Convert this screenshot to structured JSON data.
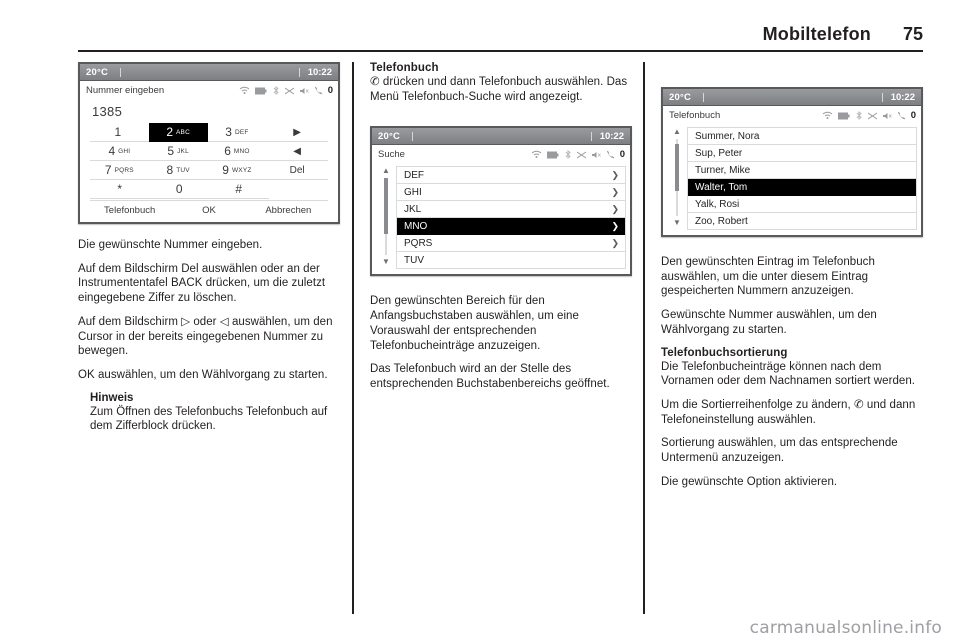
{
  "header": {
    "title": "Mobiltelefon",
    "page_number": "75"
  },
  "footer": {
    "watermark": "carmanualsonline.info"
  },
  "screens": {
    "dial": {
      "temperature": "20°C",
      "clock": "10:22",
      "title": "Nummer eingeben",
      "status_icons": [
        "signal-icon",
        "battery-icon",
        "bluetooth-icon",
        "shuffle-icon",
        "mute-icon",
        "phone-icon",
        "message-count-badge"
      ],
      "badge_value": "0",
      "entered_number": "1385",
      "keys": [
        {
          "digit": "1",
          "letters": ""
        },
        {
          "digit": "2",
          "letters": "ABC"
        },
        {
          "digit": "3",
          "letters": "DEF"
        },
        {
          "digit": "4",
          "letters": "GHI"
        },
        {
          "digit": "5",
          "letters": "JKL"
        },
        {
          "digit": "6",
          "letters": "MNO"
        },
        {
          "digit": "7",
          "letters": "PQRS"
        },
        {
          "digit": "8",
          "letters": "TUV"
        },
        {
          "digit": "9",
          "letters": "WXYZ"
        },
        {
          "digit": "*",
          "letters": ""
        },
        {
          "digit": "0",
          "letters": ""
        },
        {
          "digit": "#",
          "letters": ""
        }
      ],
      "selected_key": "2",
      "side_keys": [
        "▶",
        "◀",
        "Del"
      ],
      "footer_buttons": [
        "Telefonbuch",
        "OK",
        "Abbrechen"
      ]
    },
    "search": {
      "temperature": "20°C",
      "clock": "10:22",
      "title": "Suche",
      "badge_value": "0",
      "items": [
        "DEF",
        "GHI",
        "JKL",
        "MNO",
        "PQRS",
        "TUV"
      ],
      "selected_item": "MNO"
    },
    "phonebook": {
      "temperature": "20°C",
      "clock": "10:22",
      "title": "Telefonbuch",
      "badge_value": "0",
      "items": [
        "Summer, Nora",
        "Sup, Peter",
        "Turner, Mike",
        "Walter, Tom",
        "Yalk, Rosi",
        "Zoo, Robert"
      ],
      "selected_item": "Walter, Tom"
    }
  },
  "column1": {
    "p1": "Die gewünschte Nummer eingeben.",
    "p2": "Auf dem Bildschirm Del auswählen oder an der Instrumententafel BACK drücken, um die zuletzt eingegebene Ziffer zu löschen.",
    "p3": "Auf dem Bildschirm ▷ oder ◁ auswählen, um den Cursor in der bereits eingegebenen Nummer zu bewegen.",
    "p4": "OK auswählen, um den Wählvorgang zu starten.",
    "note_title": "Hinweis",
    "note_text": "Zum Öffnen des Telefonbuchs Telefonbuch auf dem Zifferblock drücken."
  },
  "column2": {
    "heading": "Telefonbuch",
    "p1": "✆ drücken und dann Telefonbuch auswählen. Das Menü Telefonbuch-Suche wird angezeigt.",
    "p2": "Den gewünschten Bereich für den Anfangsbuchstaben auswählen, um eine Vorauswahl der entsprechenden Telefonbucheinträge anzuzeigen.",
    "p3": "Das Telefonbuch wird an der Stelle des entsprechenden Buchstabenbereichs geöffnet."
  },
  "column3": {
    "p1": "Den gewünschten Eintrag im Telefonbuch auswählen, um die unter diesem Eintrag gespeicherten Nummern anzuzeigen.",
    "p2": "Gewünschte Nummer auswählen, um den Wählvorgang zu starten.",
    "heading": "Telefonbuchsortierung",
    "p3": "Die Telefonbucheinträge können nach dem Vornamen oder dem Nachnamen sortiert werden.",
    "p4": "Um die Sortierreihenfolge zu ändern, ✆ und dann Telefoneinstellung auswählen.",
    "p5": "Sortierung auswählen, um das entsprechende Untermenü anzuzeigen.",
    "p6": "Die gewünschte Option aktivieren."
  }
}
